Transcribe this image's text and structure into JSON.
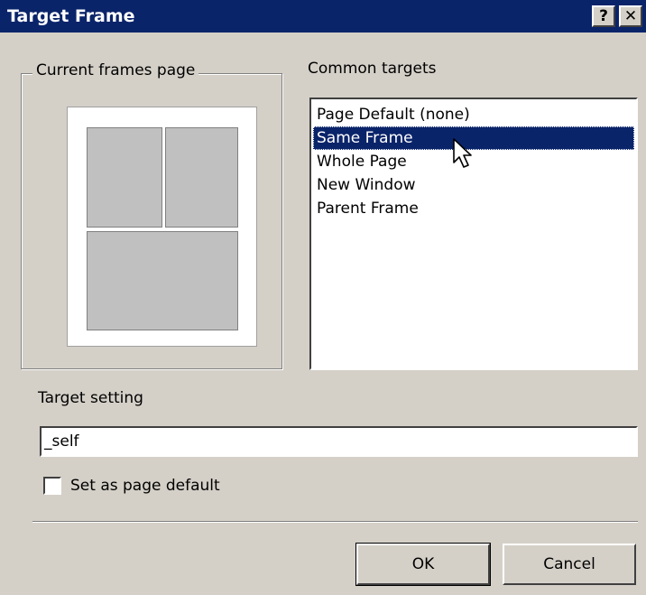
{
  "window": {
    "title": "Target Frame",
    "help_button": "?",
    "close_button": "✕"
  },
  "frames_group": {
    "legend": "Current frames page"
  },
  "common_targets": {
    "label": "Common targets",
    "items": [
      {
        "label": "Page Default (none)",
        "selected": false
      },
      {
        "label": "Same Frame",
        "selected": true
      },
      {
        "label": "Whole Page",
        "selected": false
      },
      {
        "label": "New Window",
        "selected": false
      },
      {
        "label": "Parent Frame",
        "selected": false
      }
    ]
  },
  "target_setting": {
    "label": "Target setting",
    "value": "_self"
  },
  "page_default": {
    "label": "Set as page default",
    "checked": false
  },
  "buttons": {
    "ok": "OK",
    "cancel": "Cancel"
  },
  "colors": {
    "titlebar": "#0a246a",
    "selection": "#0a246a",
    "dialog_bg": "#d4d0c8"
  }
}
